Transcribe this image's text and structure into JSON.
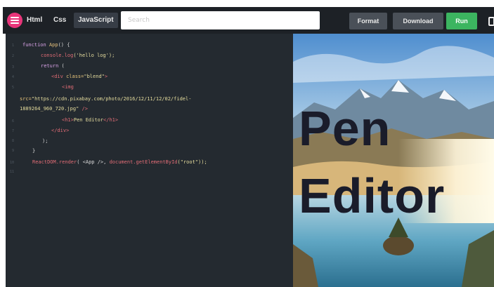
{
  "toolbar": {
    "tabs": [
      {
        "label": "Html"
      },
      {
        "label": "Css"
      },
      {
        "label": "JavaScript"
      }
    ],
    "search": {
      "value": "",
      "placeholder": "Search"
    },
    "buttons": {
      "format": "Format",
      "download": "Download",
      "run": "Run"
    }
  },
  "editor": {
    "gutter": [
      "1",
      "2",
      "3",
      "4",
      "5",
      "",
      "6",
      "7",
      "8",
      "9",
      "10",
      "11"
    ],
    "line1": {
      "kw": "function",
      "name": "App",
      "rest": "() {"
    },
    "line2": {
      "obj": "console.log",
      "arg": "('hello log');"
    },
    "line3": {
      "kw": "return",
      "rest": " ("
    },
    "line4": {
      "open": "<div",
      "attr": " class=",
      "val": "\"blend\"",
      "close": ">"
    },
    "line5": {
      "tag": "<img"
    },
    "line6": {
      "attr": "src=",
      "val": "\"https://cdn.pixabay.com/photo/2016/12/11/12/02/fidel-"
    },
    "line7": {
      "val": "1889264_960_720.jpg\"",
      "close": " />"
    },
    "line8": {
      "open": "<h1>",
      "text": "Pen Editor",
      "close": "</h1>"
    },
    "line9": {
      "tag": "</div>"
    },
    "line10": {
      "text": ");"
    },
    "line11": {
      "text": "}"
    },
    "line12": {
      "a": "ReactDOM.render",
      "b": "( <App />, ",
      "c": "document.getElementById",
      "d": "(\"root\"));"
    }
  },
  "preview": {
    "title_line1": "Pen",
    "title_line2": "Editor"
  },
  "colors": {
    "toolbar_bg": "#1d2126",
    "editor_bg": "#242a30",
    "logo": "#e8357a",
    "run": "#3cb560"
  }
}
